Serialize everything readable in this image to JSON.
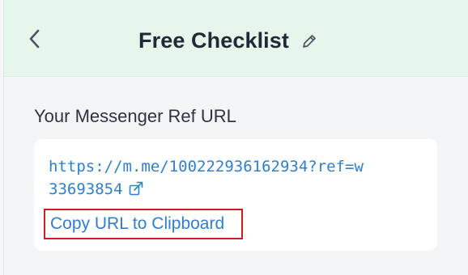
{
  "header": {
    "title": "Free Checklist",
    "back_icon": "chevron-left-icon",
    "edit_icon": "pencil-icon"
  },
  "messenger": {
    "section_label": "Your Messenger Ref URL",
    "url": "https://m.me/100222936162934?ref=w33693854",
    "copy_label": "Copy URL to Clipboard",
    "external_icon": "external-link-icon"
  },
  "colors": {
    "header_bg": "#e6f6ea",
    "link": "#2f7fd1",
    "highlight": "#cc1f1f",
    "text_dark": "#1f2937"
  }
}
